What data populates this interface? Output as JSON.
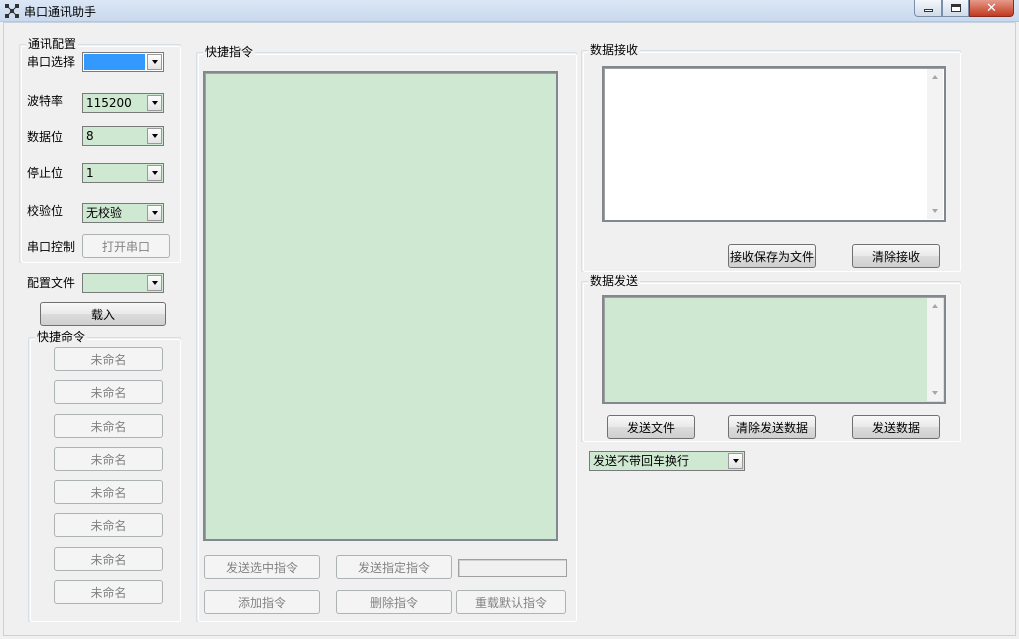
{
  "window": {
    "title": "串口通讯助手"
  },
  "config": {
    "group_label": "通讯配置",
    "port_label": "串口选择",
    "port_value": "",
    "baud_label": "波特率",
    "baud_value": "115200",
    "databits_label": "数据位",
    "databits_value": "8",
    "stopbits_label": "停止位",
    "stopbits_value": "1",
    "parity_label": "校验位",
    "parity_value": "无校验",
    "port_control_label": "串口控制",
    "open_port_button": "打开串口"
  },
  "config_file": {
    "label": "配置文件",
    "value": "",
    "load_button": "载入"
  },
  "quick_commands": {
    "group_label": "快捷命令",
    "buttons": [
      "未命名",
      "未命名",
      "未命名",
      "未命名",
      "未命名",
      "未命名",
      "未命名",
      "未命名"
    ]
  },
  "quick_instructions": {
    "group_label": "快捷指令",
    "send_selected_button": "发送选中指令",
    "send_specified_button": "发送指定指令",
    "specified_value": "",
    "add_button": "添加指令",
    "delete_button": "删除指令",
    "reload_default_button": "重载默认指令"
  },
  "receive": {
    "group_label": "数据接收",
    "save_button": "接收保存为文件",
    "clear_button": "清除接收"
  },
  "send": {
    "group_label": "数据发送",
    "send_file_button": "发送文件",
    "clear_button": "清除发送数据",
    "send_button": "发送数据"
  },
  "newline_mode": {
    "value": "发送不带回车换行"
  },
  "colors": {
    "field_green": "#cfe8d1",
    "selection_blue": "#3399ff",
    "disabled_text": "#838383"
  }
}
